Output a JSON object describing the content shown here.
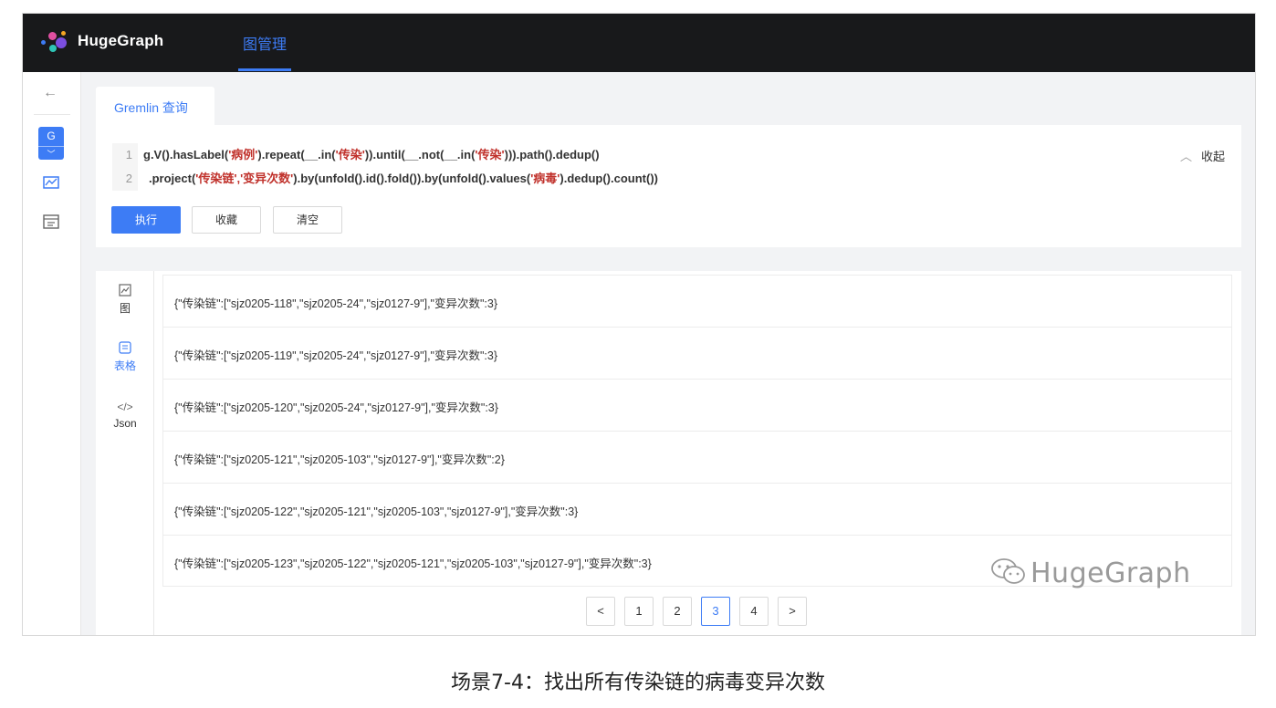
{
  "app": {
    "brand": "HugeGraph",
    "nav_tab": "图管理"
  },
  "rail": {
    "back_icon": "←",
    "graph_badge": "G"
  },
  "query": {
    "tab_label": "Gremlin 查询",
    "line1": {
      "no": "1",
      "p1": "g.V().hasLabel(",
      "s1": "'病例'",
      "p2": ").repeat(__.in(",
      "s2": "'传染'",
      "p3": ")).until(__.not(__.in(",
      "s3": "'传染'",
      "p4": "))).path().dedup()"
    },
    "line2": {
      "no": "2",
      "p1": ".project(",
      "s1": "'传染链','变异次数'",
      "p2": ").by(unfold().id().fold()).by(unfold().values(",
      "s2": "'病毒'",
      "p3": ").dedup().count())"
    },
    "collapse_label": "收起",
    "buttons": {
      "execute": "执行",
      "favorite": "收藏",
      "clear": "清空"
    }
  },
  "views": {
    "graph": "图",
    "table": "表格",
    "json": "Json"
  },
  "results": [
    "{\"传染链\":[\"sjz0205-118\",\"sjz0205-24\",\"sjz0127-9\"],\"变异次数\":3}",
    "{\"传染链\":[\"sjz0205-119\",\"sjz0205-24\",\"sjz0127-9\"],\"变异次数\":3}",
    "{\"传染链\":[\"sjz0205-120\",\"sjz0205-24\",\"sjz0127-9\"],\"变异次数\":3}",
    "{\"传染链\":[\"sjz0205-121\",\"sjz0205-103\",\"sjz0127-9\"],\"变异次数\":2}",
    "{\"传染链\":[\"sjz0205-122\",\"sjz0205-121\",\"sjz0205-103\",\"sjz0127-9\"],\"变异次数\":3}",
    "{\"传染链\":[\"sjz0205-123\",\"sjz0205-122\",\"sjz0205-121\",\"sjz0205-103\",\"sjz0127-9\"],\"变异次数\":3}"
  ],
  "pagination": {
    "prev": "<",
    "pages": [
      "1",
      "2",
      "3",
      "4"
    ],
    "current": "3",
    "next": ">"
  },
  "watermark": "HugeGraph",
  "caption": "场景7-4：找出所有传染链的病毒变异次数"
}
